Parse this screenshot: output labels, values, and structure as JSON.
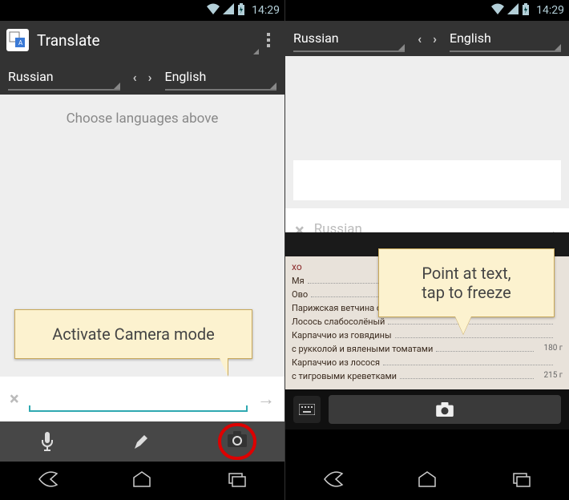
{
  "status": {
    "time": "14:29"
  },
  "appbar": {
    "title": "Translate"
  },
  "lang": {
    "source": "Russian",
    "target": "English"
  },
  "hint": "Choose languages above",
  "input": {
    "placeholder": "Russian"
  },
  "callouts": {
    "left": "Activate Camera mode",
    "right_line1": "Point at text,",
    "right_line2": "tap to freeze"
  },
  "menu_image": {
    "header": "хо",
    "rows": [
      {
        "text": "Мя",
        "price": ""
      },
      {
        "text": "Ово",
        "price": ""
      },
      {
        "text": "Парижская ветчина с дыней",
        "price": ""
      },
      {
        "text": "Лосось слабосолёный",
        "price": ""
      },
      {
        "text": "Карпаччио из говядины",
        "price": ""
      },
      {
        "text": "с рукколой и вялеными томатами",
        "price": "180 г"
      },
      {
        "text": "Карпаччио из лосося",
        "price": ""
      },
      {
        "text": "с тигровыми креветками",
        "price": "215 г"
      }
    ]
  }
}
